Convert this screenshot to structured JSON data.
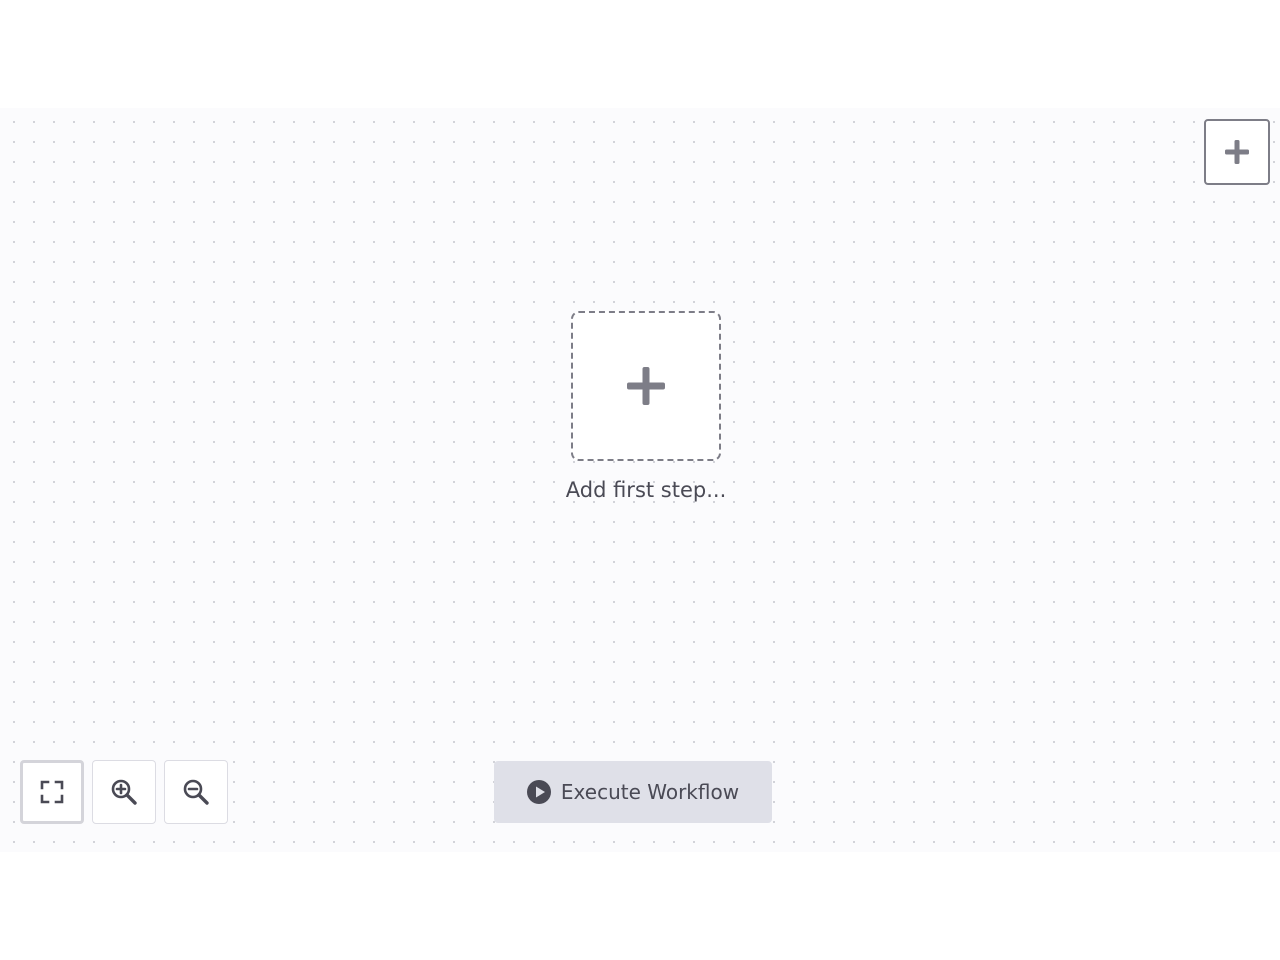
{
  "canvas": {
    "empty_state": {
      "add_step_label": "Add first step..."
    }
  },
  "toolbar": {
    "execute_label": "Execute Workflow"
  },
  "controls": {
    "items": [
      {
        "name": "fit-view-button",
        "icon": "expand-icon"
      },
      {
        "name": "zoom-in-button",
        "icon": "zoom-in-icon"
      },
      {
        "name": "zoom-out-button",
        "icon": "zoom-out-icon"
      }
    ]
  },
  "node_creator": {
    "icon": "plus-icon"
  },
  "colors": {
    "icon_gray": "#7d7d87",
    "text": "#4a4a55",
    "canvas_bg": "#fbfbfd",
    "execute_bg": "#dfe0e8"
  }
}
